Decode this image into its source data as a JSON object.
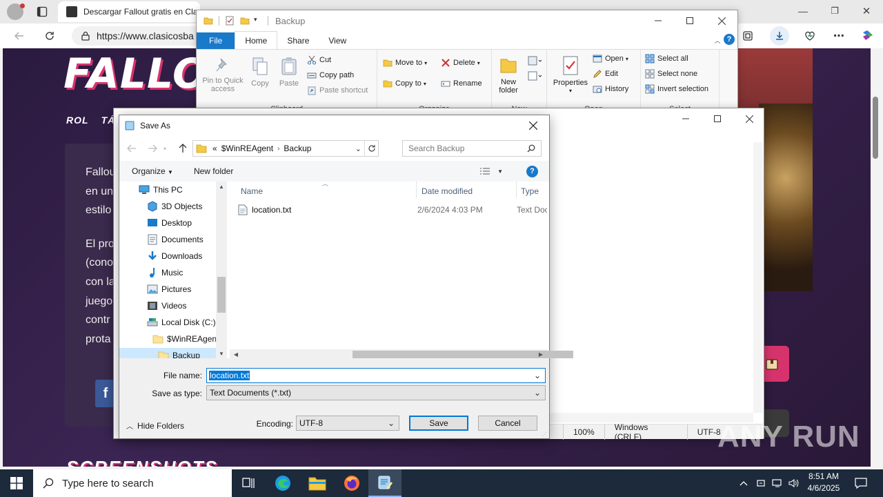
{
  "browser": {
    "tab_title": "Descargar Fallout gratis en Clas",
    "address": "https://www.clasicosba",
    "window_controls": {
      "minimize": "—",
      "maximize": "❐",
      "close": "✕"
    }
  },
  "webpage": {
    "logo": "FALLOUT",
    "nav": [
      "ROL",
      "TÁ"
    ],
    "lines": [
      "Fallou",
      "en un",
      "estilo",
      "El pro",
      "(cono",
      "con la",
      "juego",
      "contr",
      "prota"
    ],
    "fb": "f",
    "section_heading": "SCREENSHOTS"
  },
  "explorer": {
    "title": "Backup",
    "tabs": [
      "File",
      "Home",
      "Share",
      "View"
    ],
    "clipboard": {
      "label": "Clipboard",
      "pin": "Pin to Quick access",
      "copy": "Copy",
      "paste": "Paste",
      "cut": "Cut",
      "copy_path": "Copy path",
      "paste_shortcut": "Paste shortcut"
    },
    "organize": {
      "label": "Organize",
      "move_to": "Move to",
      "copy_to": "Copy to",
      "delete": "Delete",
      "rename": "Rename"
    },
    "new": {
      "label": "New",
      "new_folder": "New folder"
    },
    "open": {
      "label": "Open",
      "properties": "Properties",
      "open": "Open",
      "edit": "Edit",
      "history": "History"
    },
    "select": {
      "label": "Select",
      "select_all": "Select all",
      "select_none": "Select none",
      "invert": "Invert selection"
    }
  },
  "notepad": {
    "status": {
      "zoom": "100%",
      "line_ending": "Windows (CRLF)",
      "encoding": "UTF-8"
    }
  },
  "saveas": {
    "title": "Save As",
    "breadcrumb": {
      "prefix": "«",
      "parent": "$WinREAgent",
      "current": "Backup"
    },
    "search_placeholder": "Search Backup",
    "organize": "Organize",
    "new_folder": "New folder",
    "tree": [
      {
        "label": "This PC",
        "icon": "pc-icon"
      },
      {
        "label": "3D Objects",
        "icon": "cube-icon"
      },
      {
        "label": "Desktop",
        "icon": "desktop-icon"
      },
      {
        "label": "Documents",
        "icon": "documents-icon"
      },
      {
        "label": "Downloads",
        "icon": "downloads-icon"
      },
      {
        "label": "Music",
        "icon": "music-icon"
      },
      {
        "label": "Pictures",
        "icon": "pictures-icon"
      },
      {
        "label": "Videos",
        "icon": "videos-icon"
      },
      {
        "label": "Local Disk (C:)",
        "icon": "drive-icon"
      },
      {
        "label": "$WinREAgent",
        "icon": "folder-icon"
      },
      {
        "label": "Backup",
        "icon": "folder-icon"
      }
    ],
    "columns": {
      "name": "Name",
      "date": "Date modified",
      "type": "Type"
    },
    "files": [
      {
        "name": "location.txt",
        "date": "2/6/2024 4:03 PM",
        "type": "Text Doc"
      }
    ],
    "file_name_label": "File name:",
    "file_name": "location.txt",
    "save_as_type_label": "Save as type:",
    "save_as_type": "Text Documents (*.txt)",
    "hide_folders": "Hide Folders",
    "encoding_label": "Encoding:",
    "encoding": "UTF-8",
    "save": "Save",
    "cancel": "Cancel"
  },
  "taskbar": {
    "search_placeholder": "Type here to search",
    "time": "8:51 AM",
    "date": "4/6/2025"
  },
  "watermark": "ANY RUN",
  "colors": {
    "accent": "#0078d7",
    "file_tab": "#1979ca",
    "brand_pink": "#d6336c",
    "taskbar": "#1c2a3b"
  }
}
